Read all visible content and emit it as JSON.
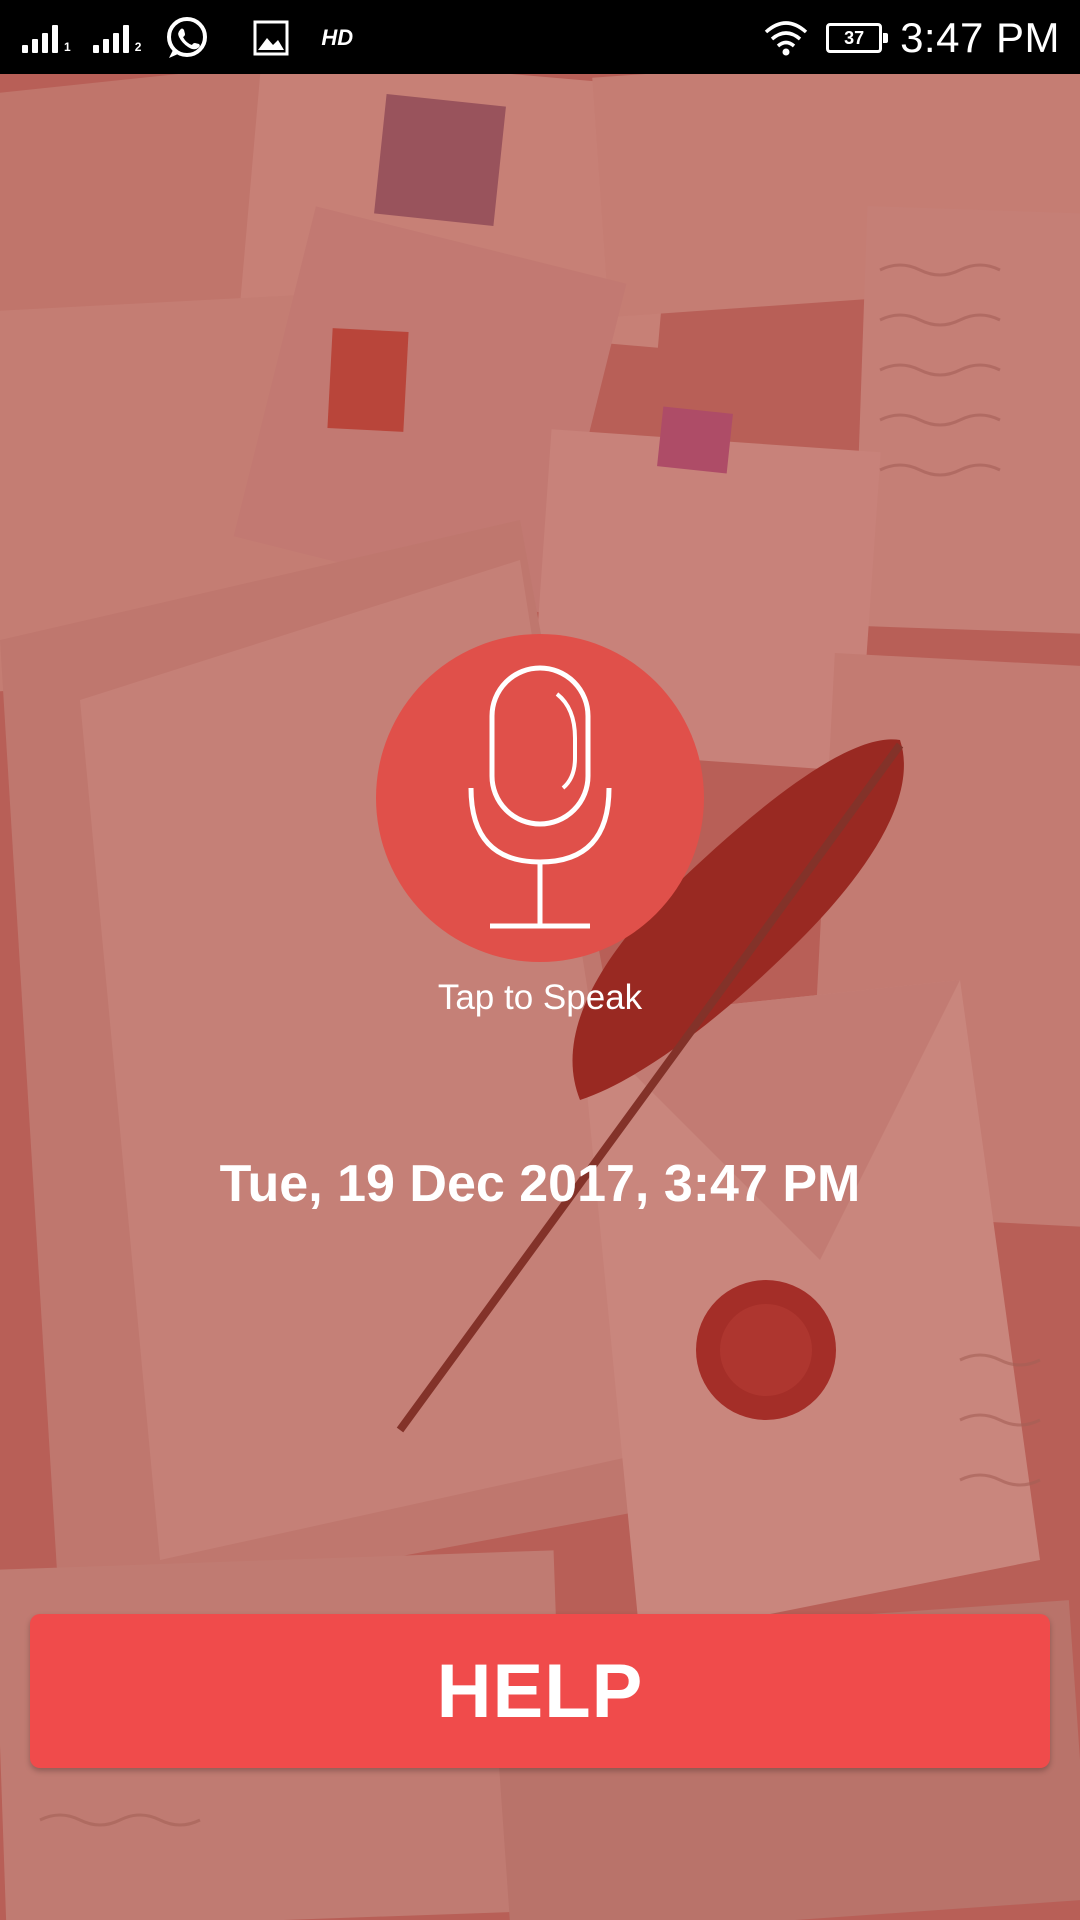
{
  "status_bar": {
    "sim1_label": "1",
    "sim2_label": "2",
    "hd_label": "HD",
    "battery_level": "37",
    "time": "3:47 PM",
    "icons": [
      "signal-icon",
      "signal-icon",
      "whatsapp-icon",
      "gallery-icon",
      "wifi-icon",
      "battery-icon"
    ]
  },
  "main": {
    "mic_icon": "microphone-icon",
    "tap_label": "Tap to Speak",
    "datetime": "Tue, 19 Dec 2017, 3:47 PM",
    "help_label": "HELP"
  },
  "colors": {
    "mic_circle": "#e0504a",
    "help_button": "#f04b4b",
    "status_bar": "#000000",
    "text": "#ffffff"
  }
}
